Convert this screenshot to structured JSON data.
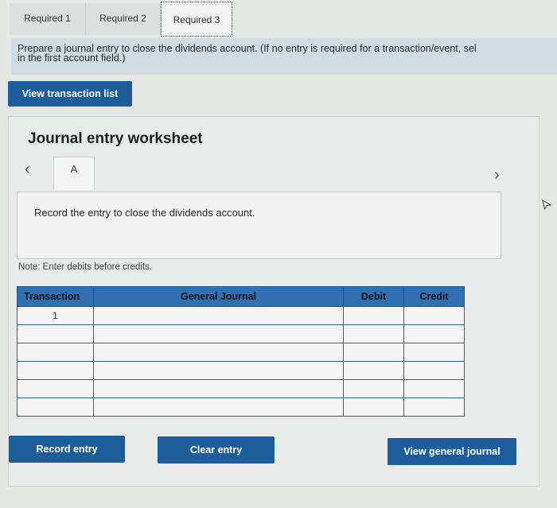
{
  "tabs": [
    "Required 1",
    "Required 2",
    "Required 3"
  ],
  "instructions": "Prepare a journal entry to close the dividends account. (If no entry is required for a transaction/event, select \"No journal entry required\" in the first account field.)",
  "instructions_line1": "Prepare a journal entry to close the dividends account. (If no entry is required for a transaction/event, sel",
  "instructions_line2": "in the first account field.)",
  "view_transaction_list": "View transaction list",
  "worksheet": {
    "title": "Journal entry worksheet",
    "step_tab": "A",
    "prompt": "Record the entry to close the dividends account.",
    "note": "Note: Enter debits before credits."
  },
  "table": {
    "headers": [
      "Transaction",
      "General Journal",
      "Debit",
      "Credit"
    ],
    "rows": [
      {
        "transaction": "1",
        "account": "",
        "debit": "",
        "credit": ""
      },
      {
        "transaction": "",
        "account": "",
        "debit": "",
        "credit": ""
      },
      {
        "transaction": "",
        "account": "",
        "debit": "",
        "credit": ""
      },
      {
        "transaction": "",
        "account": "",
        "debit": "",
        "credit": ""
      },
      {
        "transaction": "",
        "account": "",
        "debit": "",
        "credit": ""
      },
      {
        "transaction": "",
        "account": "",
        "debit": "",
        "credit": ""
      }
    ]
  },
  "buttons": {
    "record": "Record entry",
    "clear": "Clear entry",
    "view_journal": "View general journal"
  },
  "colors": {
    "button": "#1d5d99",
    "table_header": "#2f6fb2",
    "instructions_bg": "#cfdde3"
  }
}
